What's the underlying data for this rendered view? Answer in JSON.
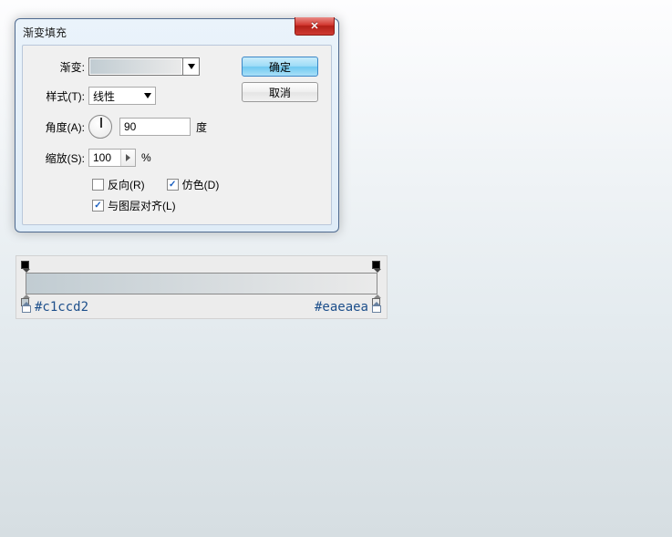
{
  "dialog": {
    "title": "渐变填充",
    "buttons": {
      "ok": "确定",
      "cancel": "取消"
    },
    "gradient": {
      "label": "渐变:"
    },
    "style": {
      "label": "样式(T):",
      "value": "线性"
    },
    "angle": {
      "label": "角度(A):",
      "value": "90",
      "unit": "度"
    },
    "scale": {
      "label": "缩放(S):",
      "value": "100",
      "unit": "%"
    },
    "checks": {
      "reverse": {
        "label": "反向(R)",
        "checked": false
      },
      "dither": {
        "label": "仿色(D)",
        "checked": true
      },
      "align": {
        "label": "与图层对齐(L)",
        "checked": true
      }
    }
  },
  "editor": {
    "left_hex": "#c1ccd2",
    "right_hex": "#eaeaea"
  }
}
